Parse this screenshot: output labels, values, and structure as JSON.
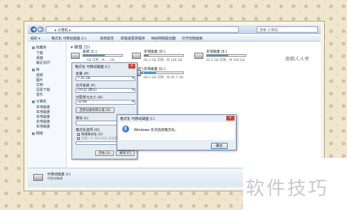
{
  "address_bar": {
    "path": "▸ 计算机 ▸",
    "search_placeholder": "搜索 计算机"
  },
  "toolbar": {
    "items": [
      "组织 ▾",
      "格式化 可移动磁盘 (I:)",
      "系统属性",
      "卸载或更改程序",
      "映射网络驱动器",
      "打开控制面板"
    ]
  },
  "sidebar": {
    "items": [
      "收藏夹",
      "下载",
      "桌面",
      "最近访问",
      "库",
      "视频",
      "图片",
      "文档",
      "迅雷下载",
      "音乐",
      "计算机",
      "本地磁盘",
      "本地磁盘",
      "本地磁盘",
      "本地磁盘",
      "本地磁盘",
      "网络"
    ]
  },
  "content": {
    "group_header": "▾ 硬盘 (5)",
    "drives": [
      {
        "name": "系统 (C:)",
        "free": "… GB 可用，共 … GB",
        "used_fraction": 0.55
      },
      {
        "name": "本地磁盘 (D:)",
        "free": "90.2 GB 可用，共 100 GB",
        "used_fraction": 0.1
      },
      {
        "name": "本地磁盘 (E:)",
        "free": "45.5 GB 可用，共 100 GB",
        "used_fraction": 0.55
      },
      {
        "name": "本地磁盘 (F:)",
        "free": "…",
        "used_fraction": 0.5
      },
      {
        "name": "本地磁盘 (G:)",
        "free": "66.0 GB 可用，共 95.7 GB",
        "used_fraction": 0.3
      }
    ]
  },
  "format_dialog": {
    "title": "格式化 可移动磁盘 (I:)",
    "close": "✕",
    "capacity_label": "容量 (P):",
    "capacity_value": "7.45 GB",
    "filesystem_label": "文件系统 (F)",
    "filesystem_value": "FAT32 (默认)",
    "allocation_label": "分配单元大小 (A)",
    "allocation_value": "32 KB",
    "restore_button": "还原设备的默认值 (D)",
    "volume_label": "卷标 (L)",
    "options_label": "格式化选项 (O)",
    "quick_format": "快速格式化 (Q)",
    "msdos_disk": "创建一个 MS-DOS 启动盘 (M)",
    "start_button": "开始 (S)",
    "close_button": "关闭 (C)"
  },
  "message_dialog": {
    "title": "格式化 可移动磁盘 (I:)",
    "close": "✕",
    "message": "Windows 无法完成格式化。",
    "ok_button": "确定",
    "icon": "info-icon"
  },
  "details_pane": {
    "name": "可移动磁盘 (I:)",
    "subtitle": "可移动磁盘"
  },
  "watermarks": {
    "top_right": "电脑人人有",
    "bottom_right": "软件技巧"
  }
}
